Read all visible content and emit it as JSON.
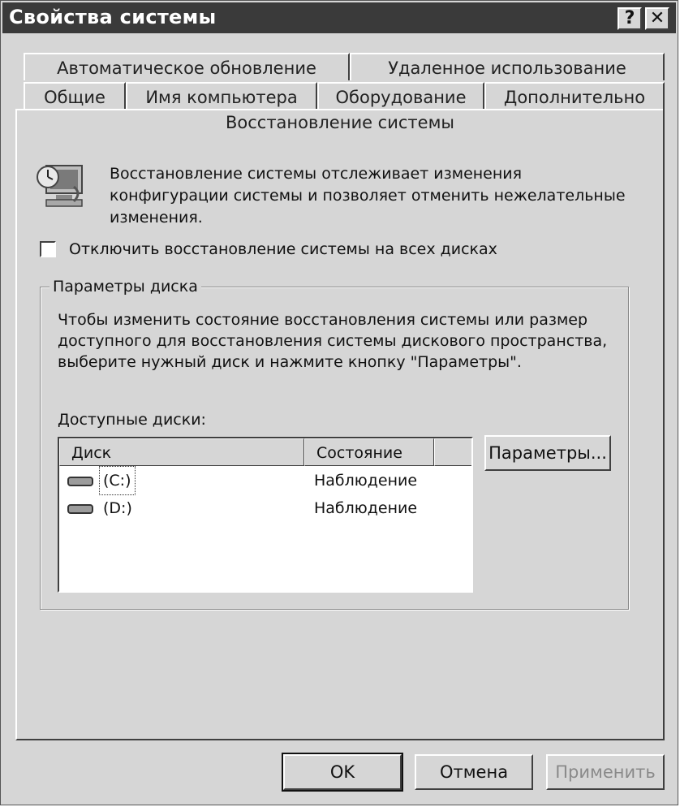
{
  "window": {
    "title": "Свойства системы",
    "help_label": "?",
    "close_label": "✕"
  },
  "tabs_row1": [
    "Автоматическое обновление",
    "Удаленное использование"
  ],
  "tabs_row2": [
    "Общие",
    "Имя компьютера",
    "Оборудование",
    "Дополнительно"
  ],
  "active_tab": "Восстановление системы",
  "description": "Восстановление системы отслеживает изменения конфигурации системы и позволяет отменить нежелательные изменения.",
  "disable_checkbox": {
    "label": "Отключить восстановление системы на всех дисках",
    "checked": false
  },
  "group": {
    "title": "Параметры диска",
    "text": "Чтобы изменить состояние восстановления системы или размер доступного для восстановления системы дискового пространства, выберите нужный диск и нажмите кнопку \"Параметры\".",
    "available_label": "Доступные диски:"
  },
  "disk_list": {
    "columns": [
      "Диск",
      "Состояние"
    ],
    "rows": [
      {
        "disk": "(C:)",
        "state": "Наблюдение",
        "selected": true
      },
      {
        "disk": "(D:)",
        "state": "Наблюдение",
        "selected": false
      }
    ]
  },
  "settings_button": "Параметры...",
  "buttons": {
    "ok": "OK",
    "cancel": "Отмена",
    "apply": "Применить"
  },
  "icons": {
    "help": "help-icon",
    "close": "close-icon",
    "system_restore": "system-restore-icon",
    "drive": "hard-drive-icon"
  }
}
